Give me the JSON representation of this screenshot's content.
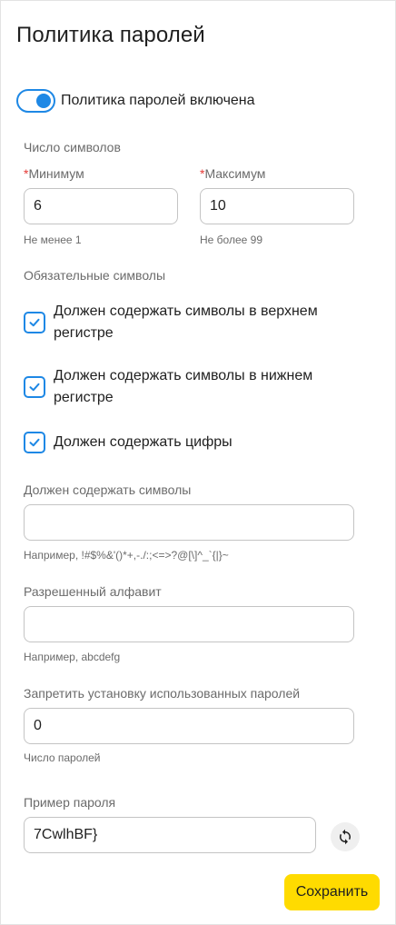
{
  "page": {
    "title": "Политика паролей"
  },
  "toggle": {
    "label": "Политика паролей включена",
    "checked": true,
    "accent": "#1e88e5"
  },
  "length": {
    "section_label": "Число символов",
    "min": {
      "label": "Минимум",
      "required": "*",
      "value": "6",
      "hint": "Не менее 1"
    },
    "max": {
      "label": "Максимум",
      "required": "*",
      "value": "10",
      "hint": "Не более 99"
    }
  },
  "required_symbols": {
    "section_label": "Обязательные символы",
    "items": [
      {
        "label": "Должен содержать символы в верхнем регистре",
        "checked": true
      },
      {
        "label": "Должен содержать символы в нижнем регистре",
        "checked": true
      },
      {
        "label": "Должен содержать цифры",
        "checked": true
      }
    ]
  },
  "must_contain": {
    "label": "Должен содержать символы",
    "value": "",
    "hint": "Например, !#$%&'()*+,-./:;<=>?@[\\]^_`{|}~"
  },
  "alphabet": {
    "label": "Разрешенный алфавит",
    "value": "",
    "hint": "Например, abcdefg"
  },
  "history": {
    "label": "Запретить установку использованных паролей",
    "value": "0",
    "hint": "Число паролей"
  },
  "example": {
    "label": "Пример пароля",
    "value": "7CwlhBF}",
    "refresh_icon": "refresh-icon"
  },
  "actions": {
    "save_label": "Сохранить",
    "save_color": "#ffdb00"
  }
}
